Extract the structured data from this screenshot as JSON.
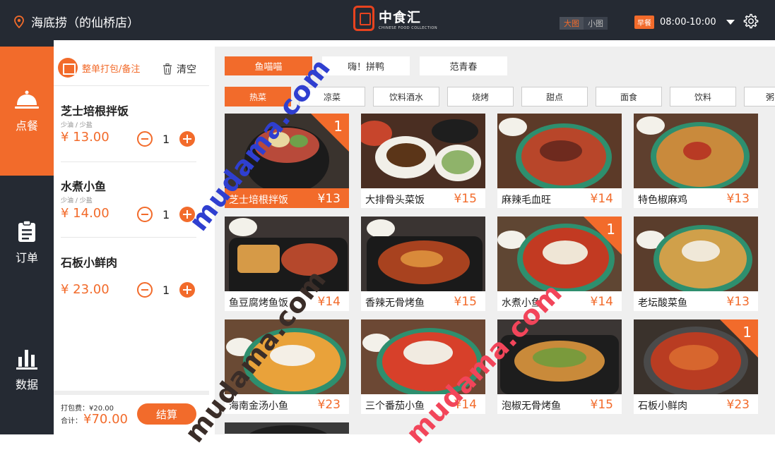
{
  "header": {
    "store_name": "海底捞（的仙桥店）",
    "logo_cn": "中食汇",
    "logo_en": "CHINESE FOOD COLLECTION",
    "view_large": "大图",
    "view_small": "小图",
    "meal_badge": "早餐",
    "meal_time": "08:00-10:00"
  },
  "nav": [
    {
      "label": "点餐",
      "icon": "cloche-icon",
      "active": true
    },
    {
      "label": "订单",
      "icon": "clipboard-icon",
      "active": false
    },
    {
      "label": "数据",
      "icon": "bar-chart-icon",
      "active": false
    }
  ],
  "order": {
    "pack_label": "整单打包/备注",
    "clear_label": "清空",
    "items": [
      {
        "name": "芝士培根拌饭",
        "note": "少油 / 少盐",
        "price": "¥ 13.00",
        "qty": "1"
      },
      {
        "name": "水煮小鱼",
        "note": "少油 / 少盐",
        "price": "¥ 14.00",
        "qty": "1"
      },
      {
        "name": "石板小鲜肉",
        "note": "",
        "price": "¥ 23.00",
        "qty": "1"
      }
    ],
    "fee_text": "打包费：¥20.00",
    "total_label": "合计：",
    "total_value": "¥70.00",
    "checkout_label": "结算"
  },
  "shops": [
    {
      "label": "鱼喵喵",
      "active": true
    },
    {
      "label": "嗨！拼鸭",
      "active": false
    },
    {
      "label": "范青春",
      "active": false
    }
  ],
  "categories": [
    {
      "label": "热菜",
      "active": true
    },
    {
      "label": "凉菜",
      "active": false
    },
    {
      "label": "饮料酒水",
      "active": false
    },
    {
      "label": "烧烤",
      "active": false
    },
    {
      "label": "甜点",
      "active": false
    },
    {
      "label": "面食",
      "active": false
    },
    {
      "label": "饮料",
      "active": false
    },
    {
      "label": "粥",
      "active": false
    }
  ],
  "dishes": [
    {
      "name": "芝士培根拌饭",
      "price": "¥13",
      "count": "1",
      "selected": true
    },
    {
      "name": "大排骨头菜饭",
      "price": "¥15",
      "count": "",
      "selected": false
    },
    {
      "name": "麻辣毛血旺",
      "price": "¥14",
      "count": "",
      "selected": false
    },
    {
      "name": "特色椒麻鸡",
      "price": "¥13",
      "count": "",
      "selected": false
    },
    {
      "name": "鱼豆腐烤鱼饭",
      "price": "¥14",
      "count": "",
      "selected": false
    },
    {
      "name": "香辣无骨烤鱼",
      "price": "¥15",
      "count": "",
      "selected": false
    },
    {
      "name": "水煮小鱼",
      "price": "¥14",
      "count": "1",
      "selected": false
    },
    {
      "name": "老坛酸菜鱼",
      "price": "¥13",
      "count": "",
      "selected": false
    },
    {
      "name": "海南金汤小鱼",
      "price": "¥23",
      "count": "",
      "selected": false
    },
    {
      "name": "三个番茄小鱼",
      "price": "¥14",
      "count": "",
      "selected": false
    },
    {
      "name": "泡椒无骨烤鱼",
      "price": "¥15",
      "count": "",
      "selected": false
    },
    {
      "name": "石板小鲜肉",
      "price": "¥23",
      "count": "1",
      "selected": false
    }
  ],
  "watermark": "mudama.com",
  "colors": {
    "accent": "#f26b2b",
    "dark": "#252a33",
    "watermark_blue": "#2f3fd0",
    "watermark_red": "#f2455a",
    "watermark_dark": "#3a2d28"
  }
}
